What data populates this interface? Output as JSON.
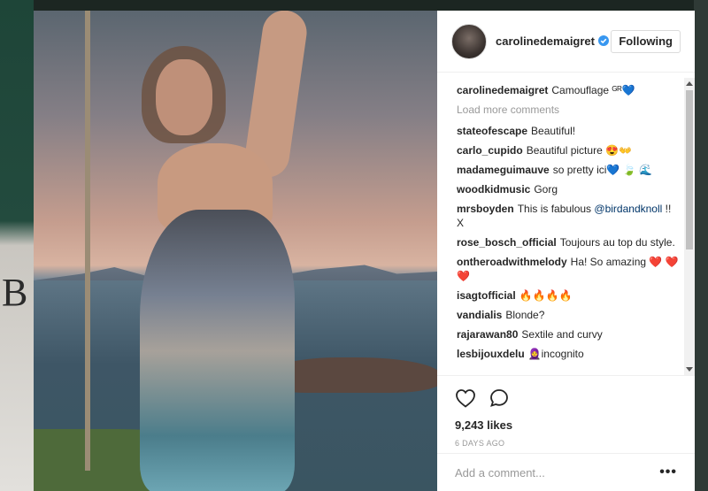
{
  "post": {
    "username": "carolinedemaigret",
    "follow_label": "Following",
    "caption_user": "carolinedemaigret",
    "caption_text": "Camouflage ᴳᴿ💙",
    "load_more": "Load more comments",
    "likes": "9,243 likes",
    "date": "6 DAYS AGO",
    "add_comment_placeholder": "Add a comment...",
    "more_options": "•••"
  },
  "comments": [
    {
      "user": "stateofescape",
      "text": "Beautiful!",
      "mention": ""
    },
    {
      "user": "carlo_cupido",
      "text": "Beautiful picture 😍👐",
      "mention": ""
    },
    {
      "user": "madameguimauve",
      "text": "so pretty ici💙 🍃 🌊",
      "mention": ""
    },
    {
      "user": "woodkidmusic",
      "text": "Gorg",
      "mention": ""
    },
    {
      "user": "mrsboyden",
      "text": "This is fabulous",
      "mention": "@birdandknoll",
      "after": " !! X"
    },
    {
      "user": "rose_bosch_official",
      "text": "Toujours au top du style.",
      "mention": ""
    },
    {
      "user": "ontheroadwithmelody",
      "text": "Ha! So amazing ❤️ ❤️❤️",
      "mention": ""
    },
    {
      "user": "isagtofficial",
      "text": "🔥🔥🔥🔥",
      "mention": ""
    },
    {
      "user": "vandialis",
      "text": "Blonde?",
      "mention": ""
    },
    {
      "user": "rajarawan80",
      "text": "Sextile and curvy",
      "mention": ""
    },
    {
      "user": "lesbijouxdelu",
      "text": "🧕incognito",
      "mention": ""
    }
  ],
  "icons": {
    "heart": "heart-icon",
    "comment": "comment-icon",
    "verified": "verified-badge-icon"
  },
  "colors": {
    "verified_blue": "#3897f0",
    "mention_blue": "#003569",
    "muted_text": "#999999"
  }
}
